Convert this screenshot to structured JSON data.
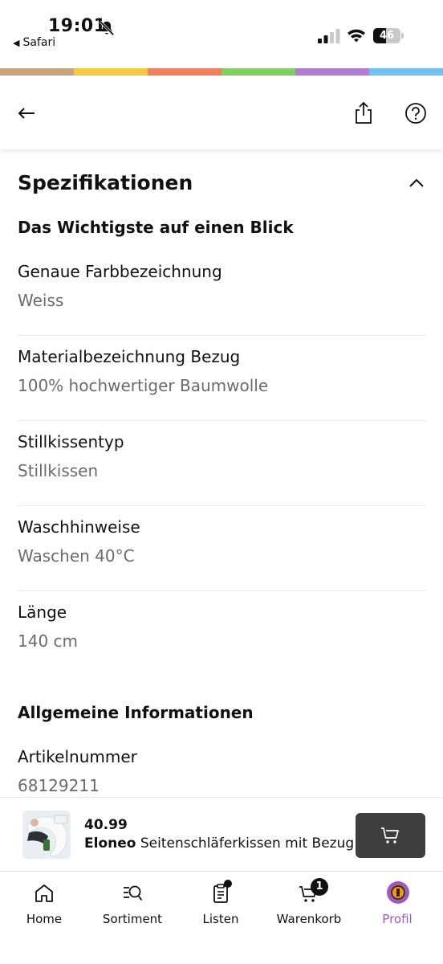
{
  "status_bar": {
    "time": "19:01",
    "back_app": "Safari",
    "battery": "46",
    "battery_level": 0.46
  },
  "brand_stripe": [
    "#c8a47e",
    "#f7c843",
    "#f07f5a",
    "#7fcf63",
    "#b37cd6",
    "#6ec1f0"
  ],
  "section": {
    "title": "Spezifikationen",
    "groups": [
      {
        "heading": "Das Wichtigste auf einen Blick",
        "items": [
          {
            "label": "Genaue Farbbezeichnung",
            "value": "Weiss"
          },
          {
            "label": "Materialbezeichnung Bezug",
            "value": "100% hochwertiger Baumwolle"
          },
          {
            "label": "Stillkissentyp",
            "value": "Stillkissen"
          },
          {
            "label": "Waschhinweise",
            "value": "Waschen 40°C"
          },
          {
            "label": "Länge",
            "value": "140 cm"
          }
        ]
      },
      {
        "heading": "Allgemeine Informationen",
        "items": [
          {
            "label": "Artikelnummer",
            "value": "68129211"
          }
        ]
      }
    ]
  },
  "product": {
    "price": "40.99",
    "brand": "Eloneo",
    "name": "Seitenschläferkissen mit Bezug"
  },
  "tabs": [
    {
      "label": "Home",
      "icon": "home-icon"
    },
    {
      "label": "Sortiment",
      "icon": "search-list-icon"
    },
    {
      "label": "Listen",
      "icon": "clipboard-icon"
    },
    {
      "label": "Warenkorb",
      "icon": "cart-icon",
      "badge": "1"
    },
    {
      "label": "Profil",
      "icon": "profile-avatar-icon",
      "active": true
    }
  ],
  "colors": {
    "accent": "#9b5bc4",
    "value_text": "#6b6b6b",
    "cart_button": "#3e3e3e"
  }
}
